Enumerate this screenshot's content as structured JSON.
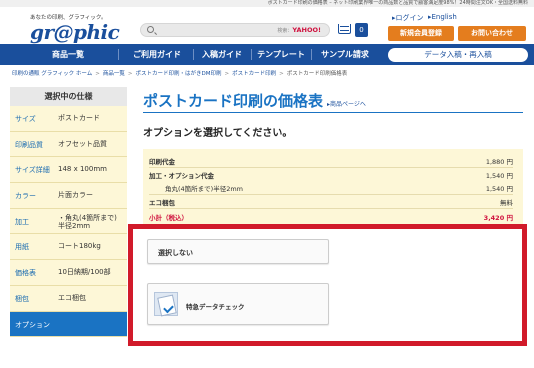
{
  "topline": "ポストカード印刷の価格表 – ネット印刷業界唯一の商品数と品質で顧客満足度98%！24時間注文OK・全国送料無料",
  "header": {
    "tagline": "あなたの印刷、グラフィック。",
    "logo": "gr@phic",
    "search": {
      "placeholder": "",
      "powered_by": "検索：",
      "brand": "YAHOO!"
    },
    "cart_count": "0",
    "login": "▸ログイン",
    "english": "▸English",
    "register": "新規会員登録",
    "contact": "お問い合わせ"
  },
  "nav": {
    "items": [
      "商品一覧",
      "ご利用ガイド",
      "入稿ガイド",
      "テンプレート",
      "サンプル請求"
    ],
    "pill": "データ入稿・再入稿"
  },
  "breadcrumb": {
    "items": [
      "印刷の通販 グラフィック ホーム",
      "商品一覧",
      "ポストカード印刷・はがきDM印刷",
      "ポストカード印刷"
    ],
    "current": "ポストカード印刷価格表"
  },
  "sidebar": {
    "title": "選択中の仕様",
    "rows": [
      {
        "k": "サイズ",
        "v": "ポストカード"
      },
      {
        "k": "印刷品質",
        "v": "オフセット品質"
      },
      {
        "k": "サイズ詳細",
        "v": "148 x 100mm"
      },
      {
        "k": "カラー",
        "v": "片面カラー"
      },
      {
        "k": "加工",
        "v": "・角丸(4箇所まで)\n半径2mm"
      },
      {
        "k": "用紙",
        "v": "コート180kg"
      },
      {
        "k": "価格表",
        "v": "10日納期/100部"
      },
      {
        "k": "梱包",
        "v": "エコ梱包"
      },
      {
        "k": "オプション",
        "v": ""
      }
    ]
  },
  "main": {
    "title": "ポストカード印刷の価格表",
    "sub_link": "▸商品ページへ",
    "prompt": "オプションを選択してください。"
  },
  "prices": {
    "print_label": "印刷代金",
    "print_value": "1,880 円",
    "option_label": "加工・オプション代金",
    "option_value": "1,540 円",
    "corner_label": "角丸(4箇所まで)半径2mm",
    "corner_value": "1,540 円",
    "eco_label": "エコ梱包",
    "eco_value": "無料",
    "subtotal_label": "小計（税込）",
    "subtotal_value": "3,420 円"
  },
  "options": {
    "none": "選択しない",
    "express_check": "特急データチェック"
  },
  "colors": {
    "brand_blue": "#1a4f9c",
    "accent_orange": "#e47d1e",
    "highlight_red": "#d11a2a",
    "price_red": "#d0113e"
  }
}
